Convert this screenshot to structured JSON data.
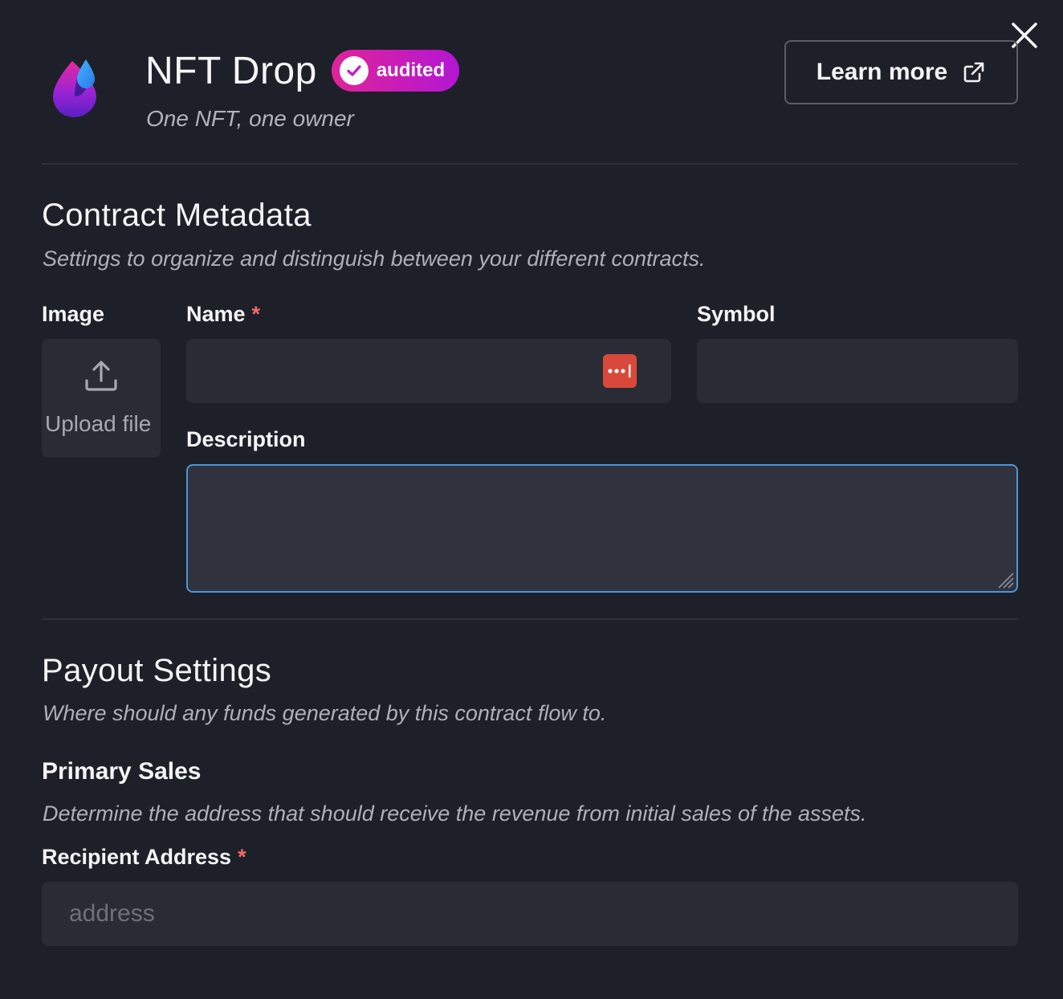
{
  "header": {
    "title": "NFT Drop",
    "badge": "audited",
    "subtitle": "One NFT, one owner",
    "learn_more": "Learn more"
  },
  "metadata": {
    "heading": "Contract Metadata",
    "description": "Settings to organize and distinguish between your different contracts.",
    "image_label": "Image",
    "upload_label": "Upload file",
    "name_label": "Name",
    "required_mark": "*",
    "symbol_label": "Symbol",
    "description_label": "Description",
    "name_value": "",
    "symbol_value": "",
    "description_value": ""
  },
  "payout": {
    "heading": "Payout Settings",
    "description": "Where should any funds generated by this contract flow to.",
    "primary_heading": "Primary Sales",
    "primary_description": "Determine the address that should receive the revenue from initial sales of the assets.",
    "recipient_label": "Recipient Address",
    "required_mark": "*",
    "recipient_placeholder": "address",
    "recipient_value": ""
  },
  "icons": {
    "close": "close-icon",
    "logo": "drop-logo-icon",
    "badge": "check-circle-icon",
    "external": "external-link-icon",
    "upload": "upload-icon",
    "password_manager": "password-manager-icon"
  },
  "colors": {
    "background": "#1e2029",
    "field": "#292c35",
    "badge_start": "#e0249a",
    "badge_end": "#b316d4",
    "focus_border": "#4c95d8",
    "required": "#f26b6b"
  }
}
